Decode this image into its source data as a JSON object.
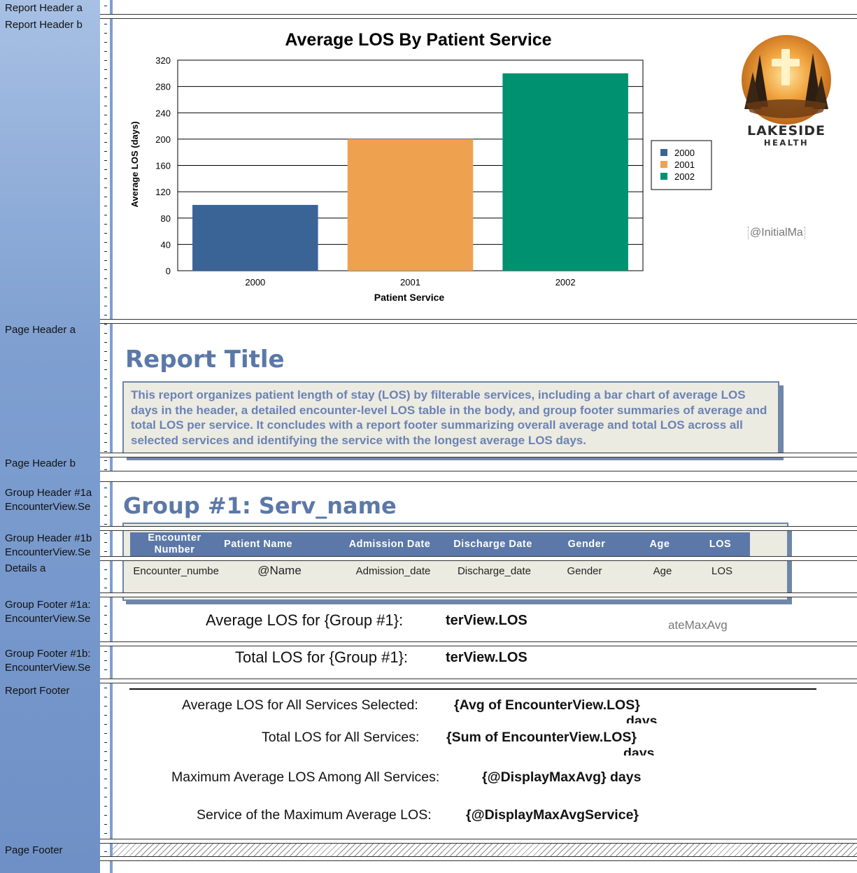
{
  "sections": {
    "report_header_a": "Report Header a",
    "report_header_b": "Report Header b",
    "page_header_a": "Page Header a",
    "page_header_b": "Page Header b",
    "group_header_1a": "Group Header #1a\n EncounterView.Se",
    "group_header_1b": "Group Header #1b\n EncounterView.Se",
    "details_a": "Details a",
    "group_footer_1a": "Group Footer #1a:\n EncounterView.Se",
    "group_footer_1b": "Group Footer #1b:\n EncounterView.Se",
    "report_footer": "Report Footer",
    "page_footer": "Page Footer"
  },
  "chart_data": {
    "type": "bar",
    "title": "Average LOS By Patient Service",
    "xlabel": "Patient Service",
    "ylabel": "Average LOS (days)",
    "categories": [
      "2000",
      "2001",
      "2002"
    ],
    "ylim": [
      0,
      320
    ],
    "yticks": [
      "0",
      "40",
      "80",
      "120",
      "160",
      "200",
      "240",
      "280",
      "320"
    ],
    "grid": true,
    "legend_position": "right",
    "series": [
      {
        "name": "2000",
        "values": [
          100,
          null,
          null
        ],
        "color": "#3a6496"
      },
      {
        "name": "2001",
        "values": [
          null,
          200,
          null
        ],
        "color": "#eea250"
      },
      {
        "name": "2002",
        "values": [
          null,
          null,
          300
        ],
        "color": "#009270"
      }
    ]
  },
  "logo": {
    "line1": "LAKESIDE",
    "line2": "HEALTH"
  },
  "header_fields": {
    "initial_max": "@InitialMa"
  },
  "page_header": {
    "title": "Report Title",
    "description": "This report organizes patient length of stay (LOS) by filterable services, including a bar chart of average LOS days in the header, a detailed encounter-level LOS table in the body, and group footer summaries of average and total LOS per service. It concludes with a report footer summarizing overall average and total LOS across all selected services and identifying the service with the longest average LOS days."
  },
  "group_header": {
    "title": "Group #1: Serv_name"
  },
  "table": {
    "columns": [
      "Encounter Number",
      "Patient Name",
      "Admission Date",
      "Discharge  Date",
      "Gender",
      "Age",
      "LOS"
    ],
    "fields": [
      "Encounter_numbe",
      "@Name",
      "Admission_date",
      "Discharge_date",
      "Gender",
      "Age",
      "LOS"
    ]
  },
  "group_footer": {
    "avg_label": "Average LOS for {Group #1}:",
    "avg_value": "terView.LOS",
    "date_max_avg": "ateMaxAvg",
    "total_label": "Total LOS for {Group #1}:",
    "total_value": "terView.LOS"
  },
  "report_footer": {
    "avg_label": "Average LOS for All Services Selected:",
    "avg_value": "{Avg of EncounterView.LOS}",
    "avg_suffix": "days",
    "total_label": "Total LOS for All Services:",
    "total_value": "{Sum of EncounterView.LOS}",
    "total_suffix": "days",
    "max_label": "Maximum Average LOS  Among All Services:",
    "max_value": "{@DisplayMaxAvg} days",
    "svc_label": "Service of the Maximum Average LOS:",
    "svc_value": "{@DisplayMaxAvgService}"
  }
}
